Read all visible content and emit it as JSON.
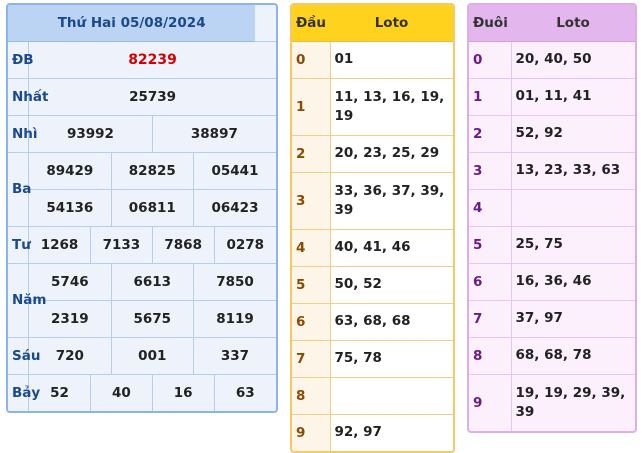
{
  "results": {
    "title": "Thứ Hai 05/08/2024",
    "rows": [
      {
        "label": "ĐB",
        "values": [
          "82239"
        ]
      },
      {
        "label": "Nhất",
        "values": [
          "25739"
        ]
      },
      {
        "label": "Nhì",
        "values": [
          "93992",
          "38897"
        ]
      },
      {
        "label": "Ba",
        "lines": [
          [
            "89429",
            "82825",
            "05441"
          ],
          [
            "54136",
            "06811",
            "06423"
          ]
        ]
      },
      {
        "label": "Tư",
        "values": [
          "1268",
          "7133",
          "7868",
          "0278"
        ]
      },
      {
        "label": "Năm",
        "lines": [
          [
            "5746",
            "6613",
            "7850"
          ],
          [
            "2319",
            "5675",
            "8119"
          ]
        ]
      },
      {
        "label": "Sáu",
        "values": [
          "720",
          "001",
          "337"
        ]
      },
      {
        "label": "Bảy",
        "values": [
          "52",
          "40",
          "16",
          "63"
        ]
      }
    ],
    "special_color": "#d60000"
  },
  "dau": {
    "headers": [
      "Đầu",
      "Loto"
    ],
    "rows": [
      {
        "key": "0",
        "value": "01"
      },
      {
        "key": "1",
        "value": "11, 13, 16, 19, 19"
      },
      {
        "key": "2",
        "value": "20, 23, 25, 29"
      },
      {
        "key": "3",
        "value": "33, 36, 37, 39, 39"
      },
      {
        "key": "4",
        "value": "40, 41, 46"
      },
      {
        "key": "5",
        "value": "50, 52"
      },
      {
        "key": "6",
        "value": "63, 68, 68"
      },
      {
        "key": "7",
        "value": "75, 78"
      },
      {
        "key": "8",
        "value": ""
      },
      {
        "key": "9",
        "value": "92, 97"
      }
    ]
  },
  "duoi": {
    "headers": [
      "Đuôi",
      "Loto"
    ],
    "rows": [
      {
        "key": "0",
        "value": "20, 40, 50"
      },
      {
        "key": "1",
        "value": "01, 11, 41"
      },
      {
        "key": "2",
        "value": "52, 92"
      },
      {
        "key": "3",
        "value": "13, 23, 33, 63"
      },
      {
        "key": "4",
        "value": ""
      },
      {
        "key": "5",
        "value": "25, 75"
      },
      {
        "key": "6",
        "value": "16, 36, 46"
      },
      {
        "key": "7",
        "value": "37, 97"
      },
      {
        "key": "8",
        "value": "68, 68, 78"
      },
      {
        "key": "9",
        "value": "19, 19, 29, 39, 39"
      }
    ]
  }
}
